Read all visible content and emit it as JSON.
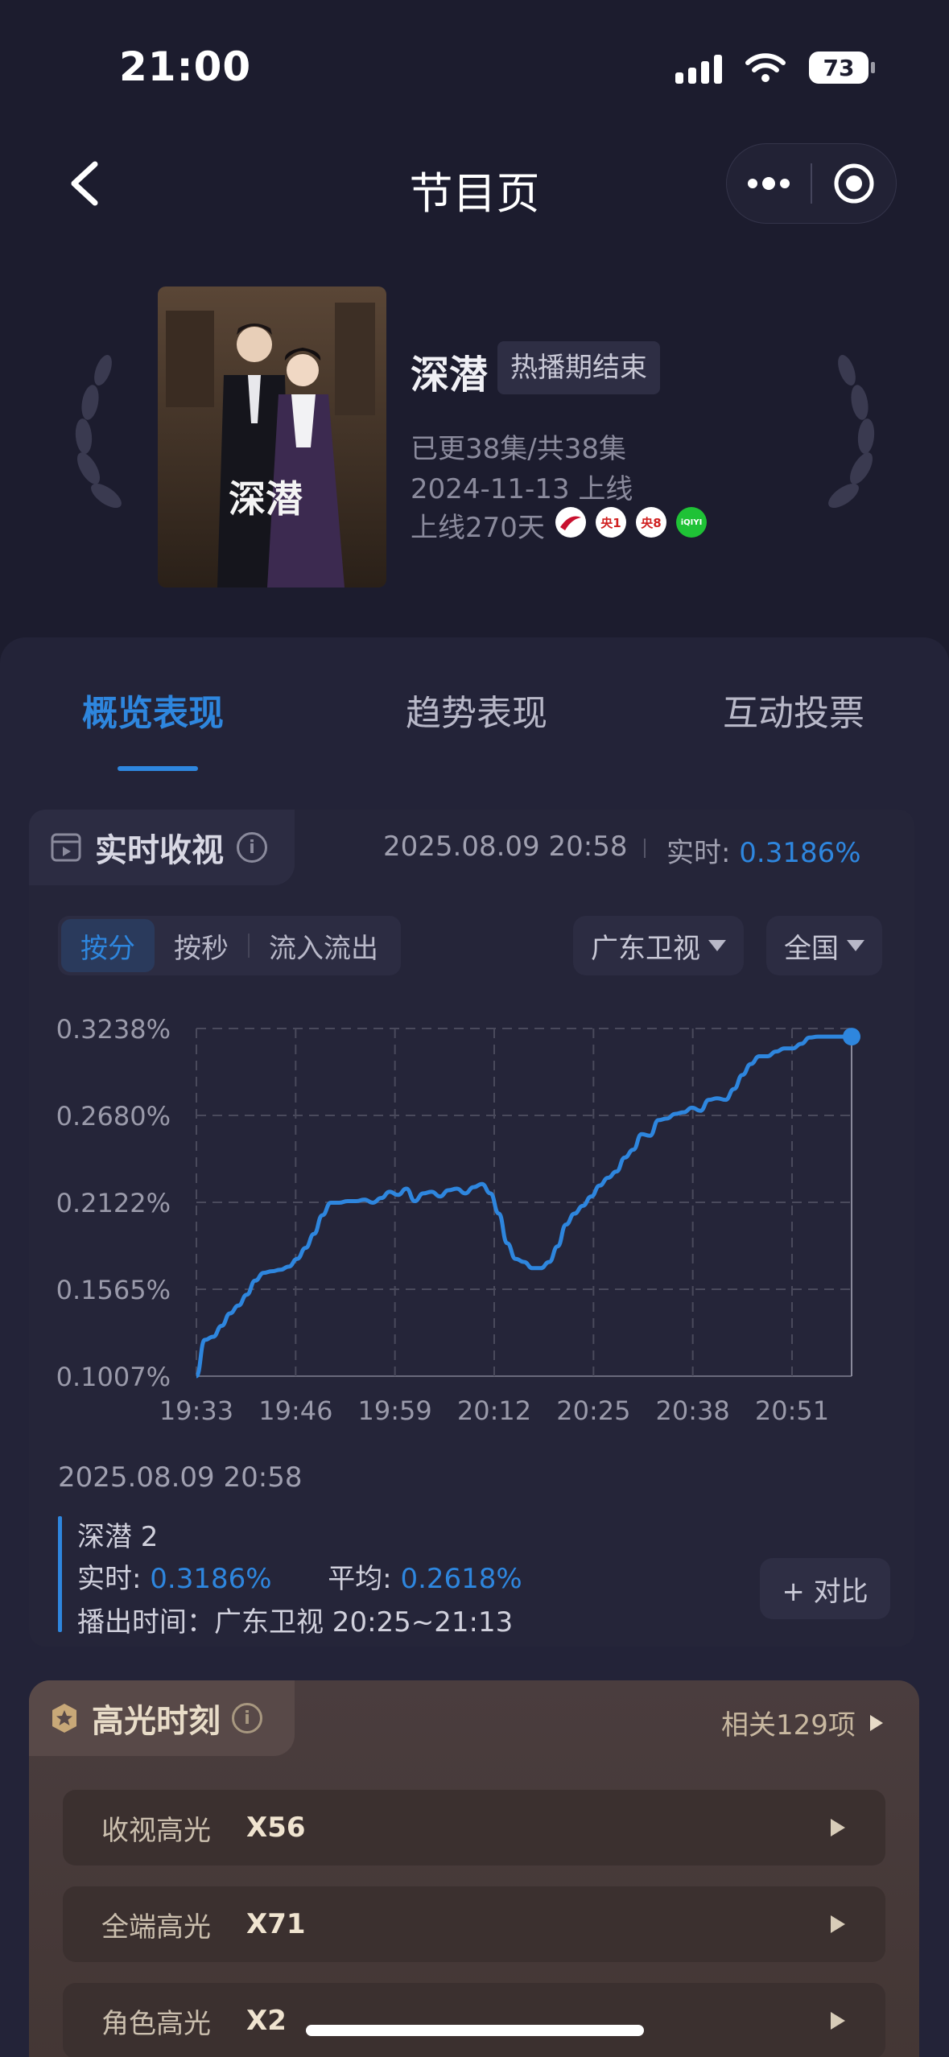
{
  "status_bar": {
    "time": "21:00",
    "battery": "73"
  },
  "nav": {
    "title": "节目页"
  },
  "show": {
    "poster_title": "深潜",
    "title": "深潜",
    "status": "热播期结束",
    "episodes": "已更38集/共38集",
    "release": "2024-11-13 上线",
    "days_online": "上线270天",
    "channels": [
      {
        "name": "广东卫视",
        "label": "",
        "color": "#c8102e"
      },
      {
        "name": "央1",
        "label": "央1",
        "color": "#d02020"
      },
      {
        "name": "央8",
        "label": "央8",
        "color": "#d02020"
      },
      {
        "name": "爱奇艺",
        "label": "iQIYI",
        "color": "#1fc236"
      }
    ]
  },
  "tabs": [
    {
      "label": "概览表现",
      "active": true
    },
    {
      "label": "趋势表现",
      "active": false
    },
    {
      "label": "互动投票",
      "active": false
    }
  ],
  "realtime": {
    "label": "实时收视",
    "timestamp": "2025.08.09 20:58",
    "current_label": "实时:",
    "current_value": "0.3186%",
    "segments": [
      {
        "label": "按分",
        "active": true
      },
      {
        "label": "按秒",
        "active": false
      },
      {
        "label": "流入流出",
        "active": false
      }
    ],
    "channel_filter": "广东卫视",
    "region_filter": "全国"
  },
  "chart_data": {
    "type": "line",
    "y_ticks": [
      "0.3238%",
      "0.2680%",
      "0.2122%",
      "0.1565%",
      "0.1007%"
    ],
    "x_ticks": [
      "19:33",
      "19:46",
      "19:59",
      "20:12",
      "20:25",
      "20:38",
      "20:51"
    ],
    "ylim": [
      0.1007,
      0.3238
    ],
    "xlim": [
      0,
      78
    ],
    "color": "#2e86de",
    "series": [
      {
        "x": [
          0,
          1,
          2,
          3,
          4,
          5,
          6,
          7,
          8,
          9,
          10,
          11,
          12,
          13,
          14,
          15,
          16,
          17,
          18,
          19,
          20,
          21,
          22,
          23,
          24,
          25,
          26,
          27,
          28,
          29,
          30,
          31,
          32,
          33,
          34,
          35,
          36,
          37,
          38,
          39,
          40,
          41,
          42,
          43,
          44,
          45,
          46,
          47,
          48,
          49,
          50,
          51,
          52,
          53,
          54,
          55,
          56,
          57,
          58,
          59,
          60,
          61,
          62,
          63,
          64,
          65,
          66,
          67,
          68,
          69,
          70,
          71,
          72,
          73,
          74,
          75,
          76,
          77,
          78
        ],
        "values": [
          0.1007,
          0.124,
          0.126,
          0.133,
          0.141,
          0.146,
          0.153,
          0.162,
          0.167,
          0.168,
          0.169,
          0.171,
          0.176,
          0.183,
          0.192,
          0.204,
          0.212,
          0.212,
          0.213,
          0.213,
          0.214,
          0.212,
          0.215,
          0.219,
          0.217,
          0.221,
          0.213,
          0.218,
          0.219,
          0.216,
          0.22,
          0.221,
          0.218,
          0.222,
          0.224,
          0.218,
          0.205,
          0.186,
          0.176,
          0.174,
          0.17,
          0.17,
          0.174,
          0.184,
          0.198,
          0.205,
          0.21,
          0.216,
          0.223,
          0.228,
          0.232,
          0.241,
          0.246,
          0.256,
          0.255,
          0.265,
          0.266,
          0.269,
          0.27,
          0.273,
          0.271,
          0.278,
          0.279,
          0.278,
          0.285,
          0.294,
          0.301,
          0.306,
          0.306,
          0.309,
          0.311,
          0.311,
          0.314,
          0.318,
          0.3186,
          0.3186,
          0.3186,
          0.3186,
          0.3186
        ]
      }
    ],
    "grid": true
  },
  "detail": {
    "date": "2025.08.09 20:58",
    "program": "深潜 2",
    "current_label": "实时:",
    "current_value": "0.3186%",
    "avg_label": "平均:",
    "avg_value": "0.2618%",
    "air_time": "播出时间：广东卫视 20:25~21:13",
    "compare_label": "+ 对比"
  },
  "highlights": {
    "label": "高光时刻",
    "related": "相关129项",
    "items": [
      {
        "name": "收视高光",
        "value": "X56"
      },
      {
        "name": "全端高光",
        "value": "X71"
      },
      {
        "name": "角色高光",
        "value": "X2"
      }
    ]
  }
}
